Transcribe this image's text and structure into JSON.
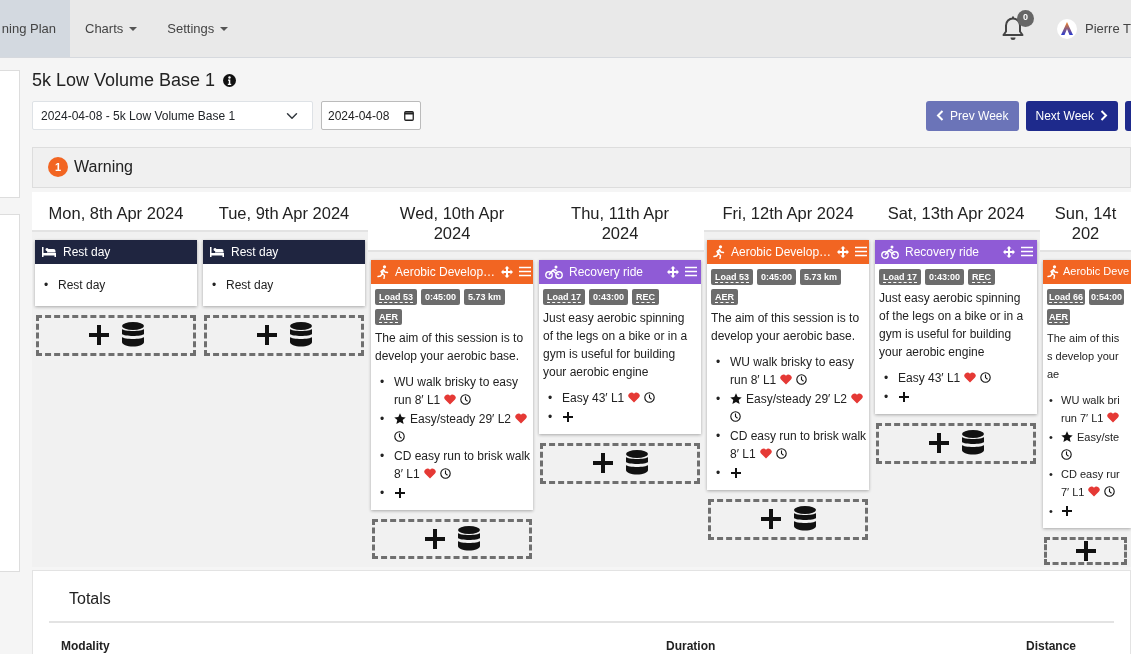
{
  "navbar": {
    "items": [
      {
        "label": "ning Plan",
        "selected": true,
        "dropdown": false
      },
      {
        "label": "Charts",
        "selected": false,
        "dropdown": true
      },
      {
        "label": "Settings",
        "selected": false,
        "dropdown": true
      }
    ],
    "notifications": "0",
    "user": "Pierre T"
  },
  "plan": {
    "title": "5k Low Volume Base 1",
    "week_select": "2024-04-08 - 5k Low Volume Base 1",
    "date": "2024-04-08",
    "buttons": [
      {
        "label": "Prev Week",
        "kind": "prev"
      },
      {
        "label": "Next Week",
        "kind": "next"
      },
      {
        "kind": "cut"
      }
    ]
  },
  "warning": {
    "count": "1",
    "label": "Warning"
  },
  "days": [
    {
      "title": "Mon, 8th Apr 2024",
      "sessions": [
        {
          "kind": "rest",
          "title": "Rest day",
          "items": [
            {
              "marker": "•",
              "text": "Rest day"
            }
          ]
        }
      ],
      "add_slot": {
        "database": true
      }
    },
    {
      "title": "Tue, 9th Apr 2024",
      "sessions": [
        {
          "kind": "rest",
          "title": "Rest day",
          "items": [
            {
              "marker": "•",
              "text": "Rest day"
            }
          ]
        }
      ],
      "add_slot": {
        "database": true
      }
    },
    {
      "title": "Wed, 10th Apr 2024",
      "sessions": [
        {
          "kind": "run",
          "title": "Aerobic Develop…",
          "tools": true,
          "badges": [
            {
              "text": "Load 53",
              "underlined": true
            },
            {
              "text": "0:45:00",
              "underlined": false
            },
            {
              "text": "5.73 km",
              "underlined": false
            },
            {
              "text": "AER",
              "underlined": true
            }
          ],
          "description": "The aim of this session is to develop your aerobic base.",
          "steps": [
            {
              "marker": "•",
              "text": "WU walk brisky to easy\nrun 8′ L1",
              "starred": false,
              "heart": true,
              "clock": true
            },
            {
              "marker": "•",
              "text": "Easy/steady 29′ L2",
              "starred": true,
              "heart": true,
              "clock": true
            },
            {
              "marker": "•",
              "text": "CD easy run to brisk walk\n8′ L1",
              "starred": false,
              "heart": true,
              "clock": true
            }
          ],
          "add_step": {
            "marker": "•"
          }
        }
      ],
      "add_slot": {
        "database": true
      }
    },
    {
      "title": "Thu, 11th Apr 2024",
      "sessions": [
        {
          "kind": "ride",
          "title": "Recovery ride",
          "tools": true,
          "badges": [
            {
              "text": "Load 17",
              "underlined": true
            },
            {
              "text": "0:43:00",
              "underlined": false
            },
            {
              "text": "REC",
              "underlined": true
            }
          ],
          "description": "Just easy aerobic spinning of the legs on a bike or in a gym is useful for building your aerobic engine",
          "steps": [
            {
              "marker": "•",
              "text": "Easy 43′ L1",
              "starred": false,
              "heart": true,
              "clock": true
            }
          ],
          "add_step": {
            "marker": "•"
          }
        }
      ],
      "add_slot": {
        "database": true
      }
    },
    {
      "title": "Fri, 12th Apr 2024",
      "sessions": [
        {
          "kind": "run",
          "title": "Aerobic Develop…",
          "tools": true,
          "badges": [
            {
              "text": "Load 53",
              "underlined": true
            },
            {
              "text": "0:45:00",
              "underlined": false
            },
            {
              "text": "5.73 km",
              "underlined": false
            },
            {
              "text": "AER",
              "underlined": true
            }
          ],
          "description": "The aim of this session is to develop your aerobic base.",
          "steps": [
            {
              "marker": "•",
              "text": "WU walk brisky to easy\nrun 8′ L1",
              "starred": false,
              "heart": true,
              "clock": true
            },
            {
              "marker": "•",
              "text": "Easy/steady 29′ L2",
              "starred": true,
              "heart": true,
              "clock": true
            },
            {
              "marker": "•",
              "text": "CD easy run to brisk walk\n8′ L1",
              "starred": false,
              "heart": true,
              "clock": true
            }
          ],
          "add_step": {
            "marker": "•"
          }
        }
      ],
      "add_slot": {
        "database": true
      }
    },
    {
      "title": "Sat, 13th Apr 2024",
      "sessions": [
        {
          "kind": "ride",
          "title": "Recovery ride",
          "tools": true,
          "badges": [
            {
              "text": "Load 17",
              "underlined": true
            },
            {
              "text": "0:43:00",
              "underlined": false
            },
            {
              "text": "REC",
              "underlined": true
            }
          ],
          "description": "Just easy aerobic spinning of the legs on a bike or in a gym is useful for building your aerobic engine",
          "steps": [
            {
              "marker": "•",
              "text": "Easy 43′ L1",
              "starred": false,
              "heart": true,
              "clock": true
            }
          ],
          "add_step": {
            "marker": "•"
          }
        }
      ],
      "add_slot": {
        "database": true
      }
    },
    {
      "title": "Sun, 14t 202",
      "sessions": [
        {
          "kind": "run",
          "title": "Aerobic Deve",
          "badges": [
            {
              "text": "Load 66",
              "underlined": true
            },
            {
              "text": "0:54:00",
              "underlined": false
            },
            {
              "text": "AER",
              "underlined": true
            }
          ],
          "description": "The aim of this s develop your ae",
          "steps": [
            {
              "marker": "•",
              "text": "WU walk bri\nrun 7′ L1",
              "starred": false,
              "heart": true,
              "clock": false
            },
            {
              "marker": "•",
              "text": "Easy/ste",
              "starred": true,
              "heart": false,
              "clock": true
            },
            {
              "marker": "•",
              "text": "CD easy rur\n7′ L1",
              "starred": false,
              "heart": true,
              "clock": true
            }
          ],
          "add_step": {
            "marker": "•"
          }
        }
      ],
      "add_slot": {
        "database": false
      }
    }
  ],
  "totals": {
    "title": "Totals",
    "columns": [
      "Modality",
      "Duration",
      "Distance"
    ]
  }
}
